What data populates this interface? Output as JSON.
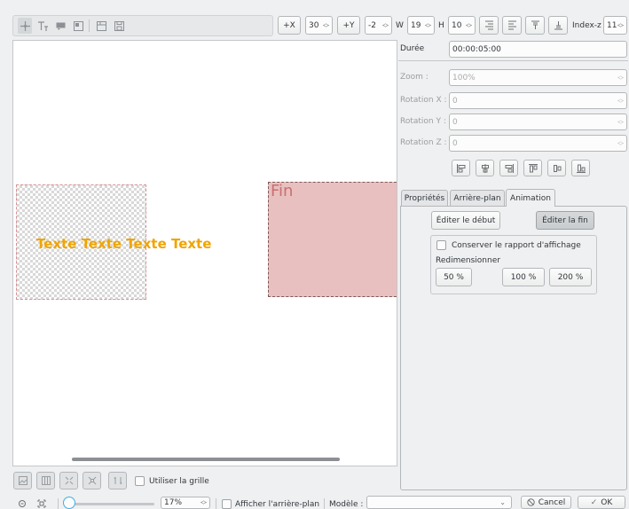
{
  "toolbar": {
    "plus_x": "+X",
    "x_value": "30",
    "plus_y": "+Y",
    "y_value": "-2",
    "w_label": "W",
    "w_value": "19",
    "h_label": "H",
    "h_value": "10",
    "index_label": "Index-z",
    "index_value": "11"
  },
  "canvas": {
    "text_item": "Texte Texte Texte Texte",
    "fin_label": "Fin",
    "text_color": "#f0a400",
    "fin_color": "#e8c0c0"
  },
  "props": {
    "duration_label": "Durée",
    "duration_value": "00:00:05:00",
    "zoom_label": "Zoom :",
    "zoom_value": "100%",
    "rotx_label": "Rotation X :",
    "rotx_value": "0",
    "roty_label": "Rotation Y :",
    "roty_value": "0",
    "rotz_label": "Rotation Z :",
    "rotz_value": "0"
  },
  "tabs": {
    "proprietes": "Propriétés",
    "arriere_plan": "Arrière-plan",
    "animation": "Animation"
  },
  "animation": {
    "edit_start": "Éditer le début",
    "edit_end": "Éditer la fin",
    "keep_ratio": "Conserver le rapport d'affichage",
    "resize_label": "Redimensionner",
    "r50": "50 %",
    "r100": "100 %",
    "r200": "200 %"
  },
  "bottom": {
    "use_grid": "Utiliser la grille",
    "zoom_value": "17%",
    "show_bg": "Afficher l'arrière-plan",
    "template_label": "Modèle :",
    "template_value": "",
    "cancel": "Cancel",
    "ok": "OK"
  }
}
